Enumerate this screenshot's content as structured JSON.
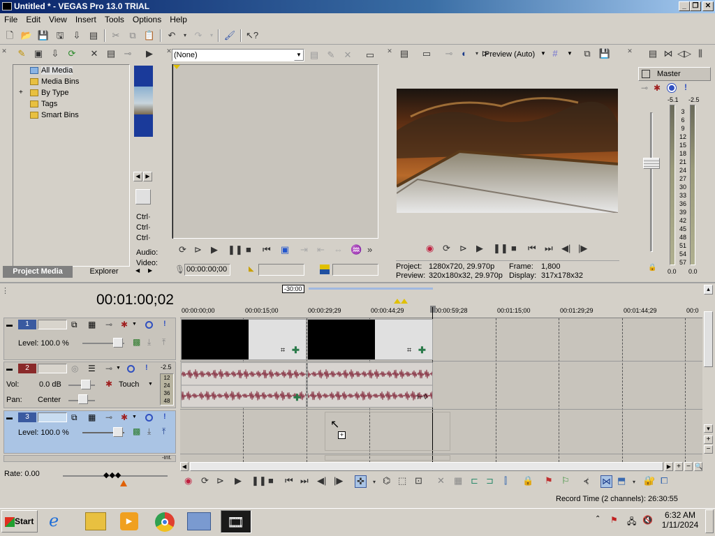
{
  "window": {
    "title": "Untitled * - VEGAS Pro 13.0 TRIAL"
  },
  "menu": [
    "File",
    "Edit",
    "View",
    "Insert",
    "Tools",
    "Options",
    "Help"
  ],
  "project_media": {
    "tree": [
      "All Media",
      "Media Bins",
      "By Type",
      "Tags",
      "Smart Bins"
    ],
    "expand_marker": "+",
    "tabs": [
      "Project Media",
      "Explorer"
    ],
    "side_labels": [
      "Ctrl·",
      "Ctrl·",
      "Ctrl·",
      "Audio:",
      "Video:"
    ]
  },
  "trimmer": {
    "preset": "(None)",
    "timecode": "00:00:00;00"
  },
  "preview": {
    "mode_label": "Preview (Auto)",
    "project_label": "Project:",
    "project_value": "1280x720, 29.970p",
    "preview_label": "Preview:",
    "preview_value": "320x180x32, 29.970p",
    "frame_label": "Frame:",
    "frame_value": "1,800",
    "display_label": "Display:",
    "display_value": "317x178x32"
  },
  "master": {
    "label": "Master",
    "peak_left": "-5.1",
    "peak_right": "-2.5",
    "scale": [
      "3",
      "6",
      "9",
      "12",
      "15",
      "18",
      "21",
      "24",
      "27",
      "30",
      "33",
      "36",
      "39",
      "42",
      "45",
      "48",
      "51",
      "54",
      "57"
    ],
    "bottom_left": "0.0",
    "bottom_right": "0.0"
  },
  "timeline": {
    "cursor_time": "00:01:00;02",
    "zoom_marker": "-30:00",
    "ruler": [
      "00:00:00;00",
      "00:00:15;00",
      "00:00:29;29",
      "00:00:44;29",
      "00:00:59;28",
      "00:01:15;00",
      "00:01:29;29",
      "00:01:44;29",
      "00:0"
    ],
    "tracks": [
      {
        "num": "1",
        "type": "video",
        "level_label": "Level: 100.0 %"
      },
      {
        "num": "2",
        "type": "audio",
        "vol_label": "Vol:",
        "vol_value": "0.0 dB",
        "pan_label": "Pan:",
        "pan_value": "Center",
        "mode": "Touch",
        "peak": "-2.5",
        "meter_marks": [
          "12",
          "24",
          "36",
          "48"
        ]
      },
      {
        "num": "3",
        "type": "video",
        "level_label": "Level: 100.0 %"
      }
    ],
    "track4_hint": "-Inf."
  },
  "rate": "Rate: 0.00",
  "status": {
    "record_time": "Record Time (2 channels): 26:30:55"
  },
  "taskbar": {
    "start": "Start",
    "time": "6:32 AM",
    "date": "1/11/2024"
  },
  "colors": {
    "title_start": "#0a246a",
    "audio_wave": "#8b3a4a",
    "selected_track": "#aac4e4"
  }
}
